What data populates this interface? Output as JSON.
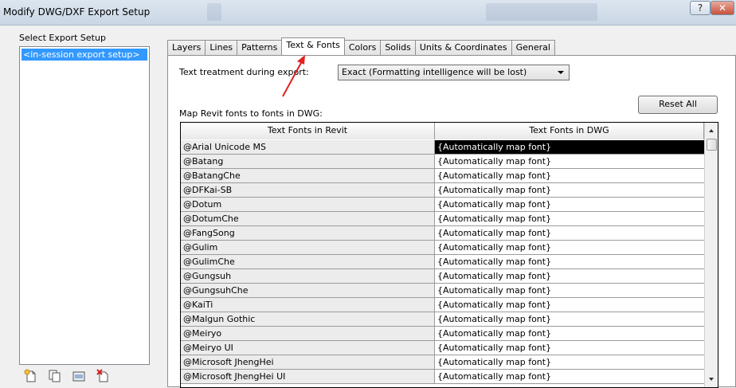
{
  "window": {
    "title": "Modify DWG/DXF Export Setup",
    "help_label": "?",
    "close_label": "✕"
  },
  "left_panel": {
    "label": "Select Export Setup",
    "items": [
      "<in-session export setup>"
    ],
    "icons": [
      "new-setup-icon",
      "duplicate-setup-icon",
      "rename-setup-icon",
      "delete-setup-icon"
    ]
  },
  "tabs": [
    "Layers",
    "Lines",
    "Patterns",
    "Text & Fonts",
    "Colors",
    "Solids",
    "Units & Coordinates",
    "General"
  ],
  "active_tab": "Text & Fonts",
  "text_treatment": {
    "label": "Text treatment during export:",
    "value": "Exact (Formatting intelligence will be lost)"
  },
  "map_label": "Map Revit fonts to fonts in DWG:",
  "reset_button": "Reset All",
  "grid": {
    "columns": [
      "Text Fonts in Revit",
      "Text Fonts in DWG"
    ],
    "rows": [
      {
        "revit": "@Arial Unicode MS",
        "dwg": "{Automatically map font}"
      },
      {
        "revit": "@Batang",
        "dwg": "{Automatically map font}"
      },
      {
        "revit": "@BatangChe",
        "dwg": "{Automatically map font}"
      },
      {
        "revit": "@DFKai-SB",
        "dwg": "{Automatically map font}"
      },
      {
        "revit": "@Dotum",
        "dwg": "{Automatically map font}"
      },
      {
        "revit": "@DotumChe",
        "dwg": "{Automatically map font}"
      },
      {
        "revit": "@FangSong",
        "dwg": "{Automatically map font}"
      },
      {
        "revit": "@Gulim",
        "dwg": "{Automatically map font}"
      },
      {
        "revit": "@GulimChe",
        "dwg": "{Automatically map font}"
      },
      {
        "revit": "@Gungsuh",
        "dwg": "{Automatically map font}"
      },
      {
        "revit": "@GungsuhChe",
        "dwg": "{Automatically map font}"
      },
      {
        "revit": "@KaiTi",
        "dwg": "{Automatically map font}"
      },
      {
        "revit": "@Malgun Gothic",
        "dwg": "{Automatically map font}"
      },
      {
        "revit": "@Meiryo",
        "dwg": "{Automatically map font}"
      },
      {
        "revit": "@Meiryo UI",
        "dwg": "{Automatically map font}"
      },
      {
        "revit": "@Microsoft JhengHei",
        "dwg": "{Automatically map font}"
      },
      {
        "revit": "@Microsoft JhengHei UI",
        "dwg": "{Automatically map font}"
      }
    ],
    "selected_row": 0
  },
  "colors": {
    "selection": "#3399ff",
    "annotation_arrow": "#e02020"
  }
}
